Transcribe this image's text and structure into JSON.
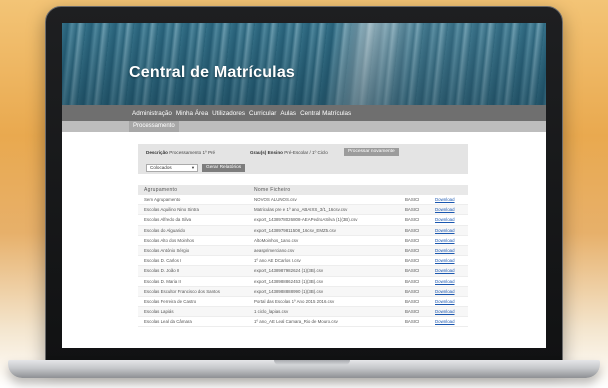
{
  "page": {
    "title": "Central de Matrículas"
  },
  "nav": {
    "items": [
      "Administração",
      "Minha Área",
      "Utilizadores",
      "Curricular",
      "Aulas",
      "Central Matrículas"
    ],
    "sub": "Processamento"
  },
  "filters": {
    "descricao_label": "Descrição",
    "descricao_value": "Processamento 1º Pré",
    "grau_label": "Grau(s) Ensino",
    "grau_value": "Pré-Escolar / 1º Ciclo",
    "process_button": "Processar novamente",
    "select_value": "Colocados",
    "report_button": "Gerar Relatórios"
  },
  "table": {
    "headers": [
      "Agrupamento",
      "Nome Ficheiro",
      "",
      ""
    ],
    "rows": [
      {
        "agrupamento": "Sem Agrupamento",
        "ficheiro": "NOVOS ALUNOS.csv",
        "tipo": "BASICI",
        "acao": "Download"
      },
      {
        "agrupamento": "Escolas Aquilino Nino Sintra",
        "ficheiro": "Matriculas pre e 1º ano_ABAIXS_3/1_16csv.csv",
        "tipo": "BASICI",
        "acao": "Download"
      },
      {
        "agrupamento": "Escolas Alfredo da Silva",
        "ficheiro": "export_1438978026808-AEAPedroASilva (1)(3B).csv",
        "tipo": "BASICI",
        "acao": "Download"
      },
      {
        "agrupamento": "Escolas do Alguarido",
        "ficheiro": "export_1438979811508_16csv_EMZ5.csv",
        "tipo": "BASICI",
        "acao": "Download"
      },
      {
        "agrupamento": "Escolas Alto dos Moinhos",
        "ficheiro": "AltoMoinhos_1ano.csv",
        "tipo": "BASICI",
        "acao": "Download"
      },
      {
        "agrupamento": "Escolas António Sérgio",
        "ficheiro": "aeasprimerciano.csv",
        "tipo": "BASICI",
        "acao": "Download"
      },
      {
        "agrupamento": "Escolas D. Carlos I",
        "ficheiro": "1º ano AE DCarlos I.csv",
        "tipo": "BASICI",
        "acao": "Download"
      },
      {
        "agrupamento": "Escolas D. João II",
        "ficheiro": "export_1438987982624 (1)(3B).csv",
        "tipo": "BASICI",
        "acao": "Download"
      },
      {
        "agrupamento": "Escolas D. Maria II",
        "ficheiro": "export_1438988862453 (1)(3B).csv",
        "tipo": "BASICI",
        "acao": "Download"
      },
      {
        "agrupamento": "Escolas Escultor Francisco dos Santos",
        "ficheiro": "export_1438988888990 (1)(3B).csv",
        "tipo": "BASICI",
        "acao": "Download"
      },
      {
        "agrupamento": "Escolas Ferreira de Castro",
        "ficheiro": "Portal das Escolas 1º Ano 2015 2016.csv",
        "tipo": "BASICI",
        "acao": "Download"
      },
      {
        "agrupamento": "Escolas Lapiás",
        "ficheiro": "1 ciclo_lapias.csv",
        "tipo": "BASICI",
        "acao": "Download"
      },
      {
        "agrupamento": "Escolas Leal da Câmara",
        "ficheiro": "1º ano_AE Leal Camara_Rio de Mouro.csv",
        "tipo": "BASICI",
        "acao": "Download"
      }
    ]
  }
}
